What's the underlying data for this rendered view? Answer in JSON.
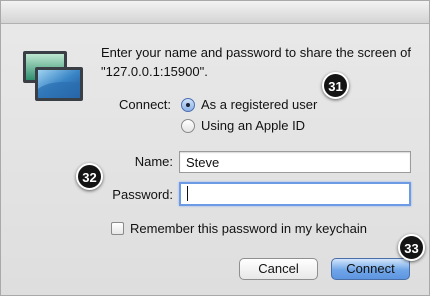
{
  "dialog": {
    "prompt": "Enter your name and password to share the screen of \"127.0.0.1:15900\"."
  },
  "connect": {
    "label": "Connect:",
    "options": [
      {
        "label": "As a registered user",
        "selected": true
      },
      {
        "label": "Using an Apple ID",
        "selected": false
      }
    ]
  },
  "fields": {
    "name_label": "Name:",
    "name_value": "Steve",
    "password_label": "Password:",
    "password_value": ""
  },
  "remember": {
    "label": "Remember this password in my keychain",
    "checked": false
  },
  "buttons": {
    "cancel": "Cancel",
    "connect": "Connect"
  },
  "badges": [
    "31",
    "32",
    "33"
  ],
  "icons": {
    "app": "screen-sharing-icon"
  },
  "colors": {
    "accent": "#5d95e0",
    "focus_ring": "#6d9ae4",
    "badge": "#141414"
  }
}
